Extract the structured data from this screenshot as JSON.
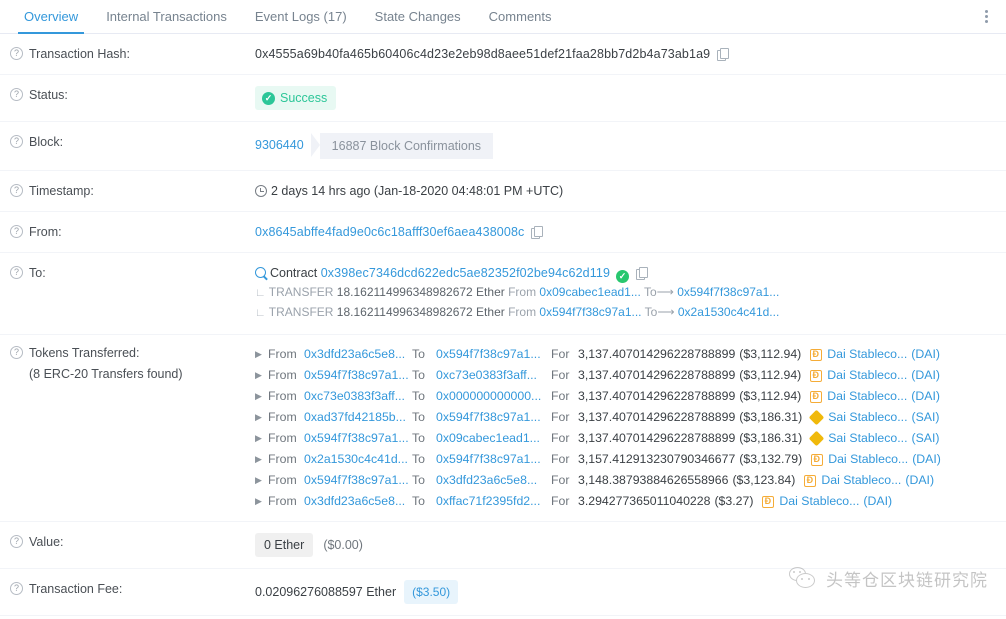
{
  "tabs": [
    {
      "label": "Overview",
      "active": true
    },
    {
      "label": "Internal Transactions",
      "active": false
    },
    {
      "label": "Event Logs (17)",
      "active": false
    },
    {
      "label": "State Changes",
      "active": false
    },
    {
      "label": "Comments",
      "active": false
    }
  ],
  "menu_icon": "kebab-menu-icon",
  "rows": {
    "tx_hash": {
      "label": "Transaction Hash:",
      "value": "0x4555a69b40fa465b60406c4d23e2eb98d8aee51def21faa28bb7d2b4a73ab1a9"
    },
    "status": {
      "label": "Status:",
      "value": "Success",
      "color": "#2cc698",
      "bg": "#e8f9f3"
    },
    "block": {
      "label": "Block:",
      "number": "9306440",
      "confirmations": "16887 Block Confirmations"
    },
    "timestamp": {
      "label": "Timestamp:",
      "value": "2 days 14 hrs ago (Jan-18-2020 04:48:01 PM +UTC)"
    },
    "from": {
      "label": "From:",
      "address": "0x8645abffe4fad9e0c6c18afff30ef6aea438008c"
    },
    "to": {
      "label": "To:",
      "contract_word": "Contract",
      "address": "0x398ec7346dcd622edc5ae82352f02be94c62d119",
      "transfers": [
        {
          "tag": "TRANSFER",
          "amount": "18.162114996348982672 Ether",
          "from_word": "From",
          "from": "0x09cabec1ead1...",
          "to_word": "To",
          "to": "0x594f7f38c97a1..."
        },
        {
          "tag": "TRANSFER",
          "amount": "18.162114996348982672 Ether",
          "from_word": "From",
          "from": "0x594f7f38c97a1...",
          "to_word": "To",
          "to": "0x2a1530c4c41d..."
        }
      ]
    },
    "tokens": {
      "label": "Tokens Transferred:",
      "sublabel": "(8 ERC-20 Transfers found)",
      "word_from": "From",
      "word_to": "To",
      "word_for": "For",
      "list": [
        {
          "from": "0x3dfd23a6c5e8...",
          "to": "0x594f7f38c97a1...",
          "amount": "3,137.407014296228788899",
          "usd": "($3,112.94)",
          "token_name": "Dai Stableco...",
          "token_symbol": "(DAI)",
          "token_icon": "dai-token-icon"
        },
        {
          "from": "0x594f7f38c97a1...",
          "to": "0xc73e0383f3aff...",
          "amount": "3,137.407014296228788899",
          "usd": "($3,112.94)",
          "token_name": "Dai Stableco...",
          "token_symbol": "(DAI)",
          "token_icon": "dai-token-icon"
        },
        {
          "from": "0xc73e0383f3aff...",
          "to": "0x000000000000...",
          "amount": "3,137.407014296228788899",
          "usd": "($3,112.94)",
          "token_name": "Dai Stableco...",
          "token_symbol": "(DAI)",
          "token_icon": "dai-token-icon"
        },
        {
          "from": "0xad37fd42185b...",
          "to": "0x594f7f38c97a1...",
          "amount": "3,137.407014296228788899",
          "usd": "($3,186.31)",
          "token_name": "Sai Stableco...",
          "token_symbol": "(SAI)",
          "token_icon": "sai-token-icon"
        },
        {
          "from": "0x594f7f38c97a1...",
          "to": "0x09cabec1ead1...",
          "amount": "3,137.407014296228788899",
          "usd": "($3,186.31)",
          "token_name": "Sai Stableco...",
          "token_symbol": "(SAI)",
          "token_icon": "sai-token-icon"
        },
        {
          "from": "0x2a1530c4c41d...",
          "to": "0x594f7f38c97a1...",
          "amount": "3,157.412913230790346677",
          "usd": "($3,132.79)",
          "token_name": "Dai Stableco...",
          "token_symbol": "(DAI)",
          "token_icon": "dai-token-icon"
        },
        {
          "from": "0x594f7f38c97a1...",
          "to": "0x3dfd23a6c5e8...",
          "amount": "3,148.38793884626558966",
          "usd": "($3,123.84)",
          "token_name": "Dai Stableco...",
          "token_symbol": "(DAI)",
          "token_icon": "dai-token-icon"
        },
        {
          "from": "0x3dfd23a6c5e8...",
          "to": "0xffac71f2395fd2...",
          "amount": "3.294277365011040228",
          "usd": "($3.27)",
          "token_name": "Dai Stableco...",
          "token_symbol": "(DAI)",
          "token_icon": "dai-token-icon"
        }
      ]
    },
    "value": {
      "label": "Value:",
      "ether": "0 Ether",
      "usd": "($0.00)"
    },
    "fee": {
      "label": "Transaction Fee:",
      "ether": "0.02096276088597 Ether",
      "usd": "($3.50)"
    }
  },
  "watermark": {
    "text": "头等仓区块链研究院",
    "logo": "wechat-logo-icon"
  }
}
